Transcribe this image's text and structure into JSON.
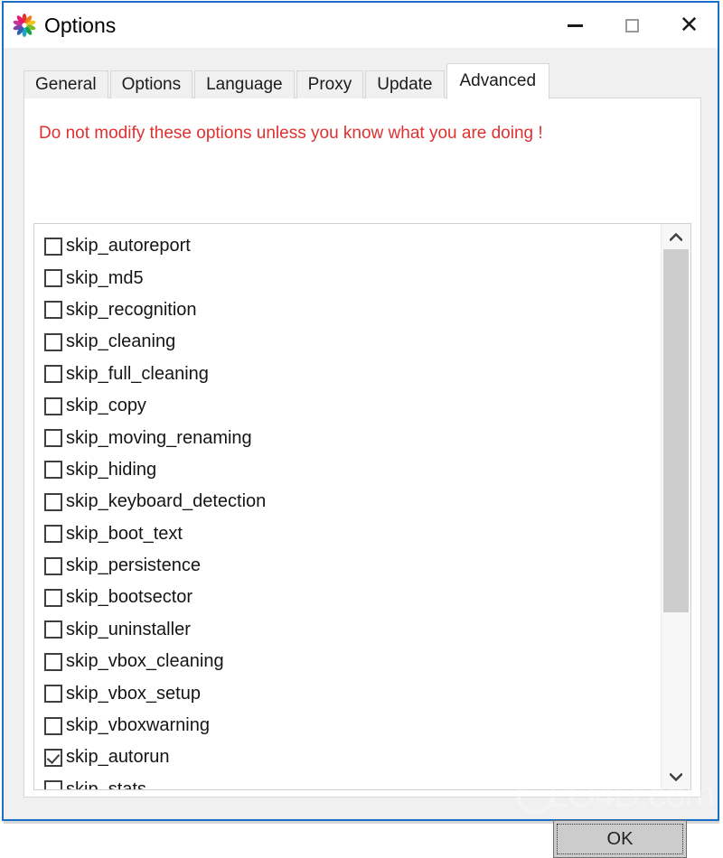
{
  "window": {
    "title": "Options",
    "icon": "pinwheel-app-icon",
    "accent_border_color": "#1a6fc4",
    "controls": {
      "minimize": "minimize-icon",
      "maximize": "maximize-icon",
      "close": "close-icon"
    }
  },
  "tabs": [
    {
      "label": "General",
      "active": false
    },
    {
      "label": "Options",
      "active": false
    },
    {
      "label": "Language",
      "active": false
    },
    {
      "label": "Proxy",
      "active": false
    },
    {
      "label": "Update",
      "active": false
    },
    {
      "label": "Advanced",
      "active": true
    }
  ],
  "panel": {
    "warning_text": "Do not modify these options unless you know what you are doing !",
    "warning_color": "#e03030"
  },
  "options": [
    {
      "label": "skip_autoreport",
      "checked": false
    },
    {
      "label": "skip_md5",
      "checked": false
    },
    {
      "label": "skip_recognition",
      "checked": false
    },
    {
      "label": "skip_cleaning",
      "checked": false
    },
    {
      "label": "skip_full_cleaning",
      "checked": false
    },
    {
      "label": "skip_copy",
      "checked": false
    },
    {
      "label": "skip_moving_renaming",
      "checked": false
    },
    {
      "label": "skip_hiding",
      "checked": false
    },
    {
      "label": "skip_keyboard_detection",
      "checked": false
    },
    {
      "label": "skip_boot_text",
      "checked": false
    },
    {
      "label": "skip_persistence",
      "checked": false
    },
    {
      "label": "skip_bootsector",
      "checked": false
    },
    {
      "label": "skip_uninstaller",
      "checked": false
    },
    {
      "label": "skip_vbox_cleaning",
      "checked": false
    },
    {
      "label": "skip_vbox_setup",
      "checked": false
    },
    {
      "label": "skip_vboxwarning",
      "checked": false
    },
    {
      "label": "skip_autorun",
      "checked": true
    },
    {
      "label": "skip_stats",
      "checked": false
    }
  ],
  "scrollbar": {
    "up_arrow": "chevron-up-icon",
    "down_arrow": "chevron-down-icon",
    "thumb_fraction": 0.705
  },
  "footer": {
    "ok_label": "OK"
  },
  "watermark": {
    "text": "LO4D.com"
  }
}
